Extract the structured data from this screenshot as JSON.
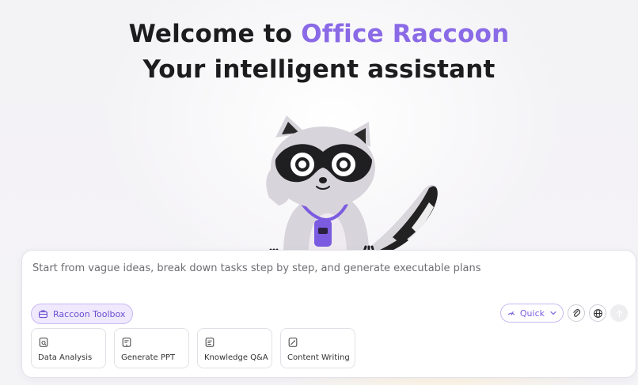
{
  "hero": {
    "line1_prefix": "Welcome to ",
    "line1_accent": "Office Raccoon",
    "line2": "Your intelligent assistant"
  },
  "mascot": {
    "icon": "raccoon-mascot"
  },
  "composer": {
    "placeholder": "Start from vague ideas, break down tasks step by step, and generate executable plans",
    "toolbox_label": "Raccoon Toolbox",
    "mode_label": "Quick",
    "controls": {
      "attach_icon": "paperclip-icon",
      "web_icon": "globe-icon",
      "send_icon": "arrow-up-icon"
    }
  },
  "shortcuts": [
    {
      "label": "Data Analysis",
      "icon": "chart-doc-icon"
    },
    {
      "label": "Generate PPT",
      "icon": "slides-icon"
    },
    {
      "label": "Knowledge Q&A",
      "icon": "knowledge-doc-icon"
    },
    {
      "label": "Content Writing",
      "icon": "write-doc-icon"
    }
  ],
  "colors": {
    "accent": "#8a6ae6",
    "toolbox_bg": "#efe9fd",
    "text": "#1c1c1e"
  }
}
